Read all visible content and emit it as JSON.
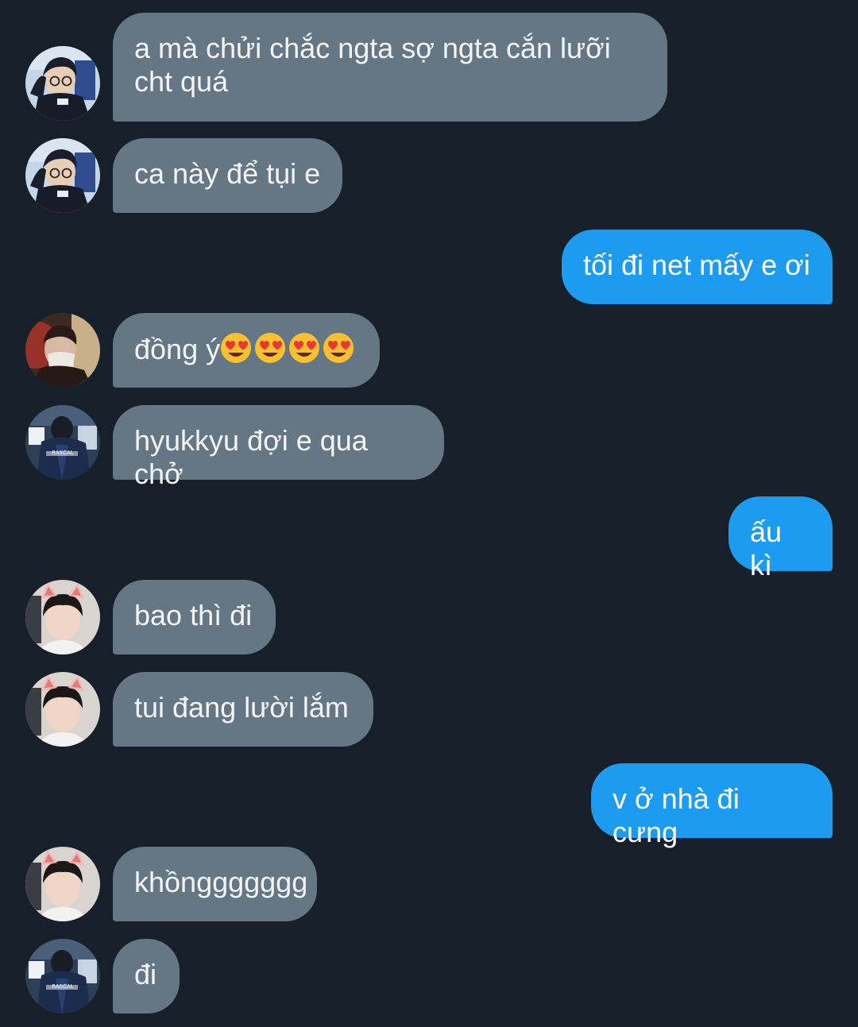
{
  "theme": {
    "background": "#17202a",
    "incoming_bubble": "#657685",
    "outgoing_bubble": "#1d9bf0",
    "text": "#f3f5f7"
  },
  "messages": [
    {
      "direction": "incoming",
      "avatar": "glasses-boy-avatar",
      "text": "a mà chửi chắc ngta sợ ngta cắn lưỡi\ncht quá"
    },
    {
      "direction": "incoming",
      "avatar": "glasses-boy-avatar",
      "text": "ca này để tụi e"
    },
    {
      "direction": "outgoing",
      "text": "tối đi net mấy e ơi"
    },
    {
      "direction": "incoming",
      "avatar": "masked-red-light-avatar",
      "text": "đồng ý",
      "emoji": [
        "heart-eyes",
        "heart-eyes",
        "heart-eyes",
        "heart-eyes"
      ]
    },
    {
      "direction": "incoming",
      "avatar": "rascal-jacket-avatar",
      "text": "hyukkyu đợi e qua chở"
    },
    {
      "direction": "outgoing",
      "text": "ấu kì"
    },
    {
      "direction": "incoming",
      "avatar": "cat-ears-avatar",
      "text": "bao thì đi"
    },
    {
      "direction": "incoming",
      "avatar": "cat-ears-avatar",
      "text": "tui đang lười lắm"
    },
    {
      "direction": "outgoing",
      "text": "v ở nhà đi cưng"
    },
    {
      "direction": "incoming",
      "avatar": "cat-ears-avatar",
      "text": "khồnggggggg"
    },
    {
      "direction": "incoming",
      "avatar": "rascal-jacket-avatar",
      "text": "đi"
    }
  ]
}
